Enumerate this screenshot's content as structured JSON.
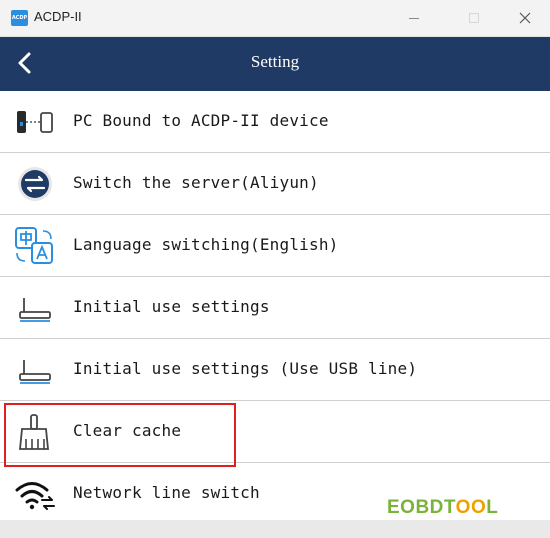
{
  "window": {
    "title": "ACDP-II",
    "app_icon_text": "ACDP"
  },
  "header": {
    "title": "Setting",
    "accent_color": "#1f3a64"
  },
  "settings_items": [
    {
      "label": "PC Bound to ACDP-II device",
      "icon": "pc-bound-icon"
    },
    {
      "label": "Switch the server(Aliyun)",
      "icon": "server-switch-icon"
    },
    {
      "label": "Language switching(English)",
      "icon": "language-icon"
    },
    {
      "label": "Initial use settings",
      "icon": "router-icon"
    },
    {
      "label": "Initial use settings (Use USB line)",
      "icon": "router-usb-icon"
    },
    {
      "label": "Clear cache",
      "icon": "broom-icon"
    },
    {
      "label": "Network line switch",
      "icon": "wifi-switch-icon"
    }
  ],
  "highlight": {
    "target": "Clear cache",
    "color": "#e02020"
  },
  "watermark": {
    "part1": "EOBDT",
    "part2": "OO",
    "part3": "L"
  }
}
